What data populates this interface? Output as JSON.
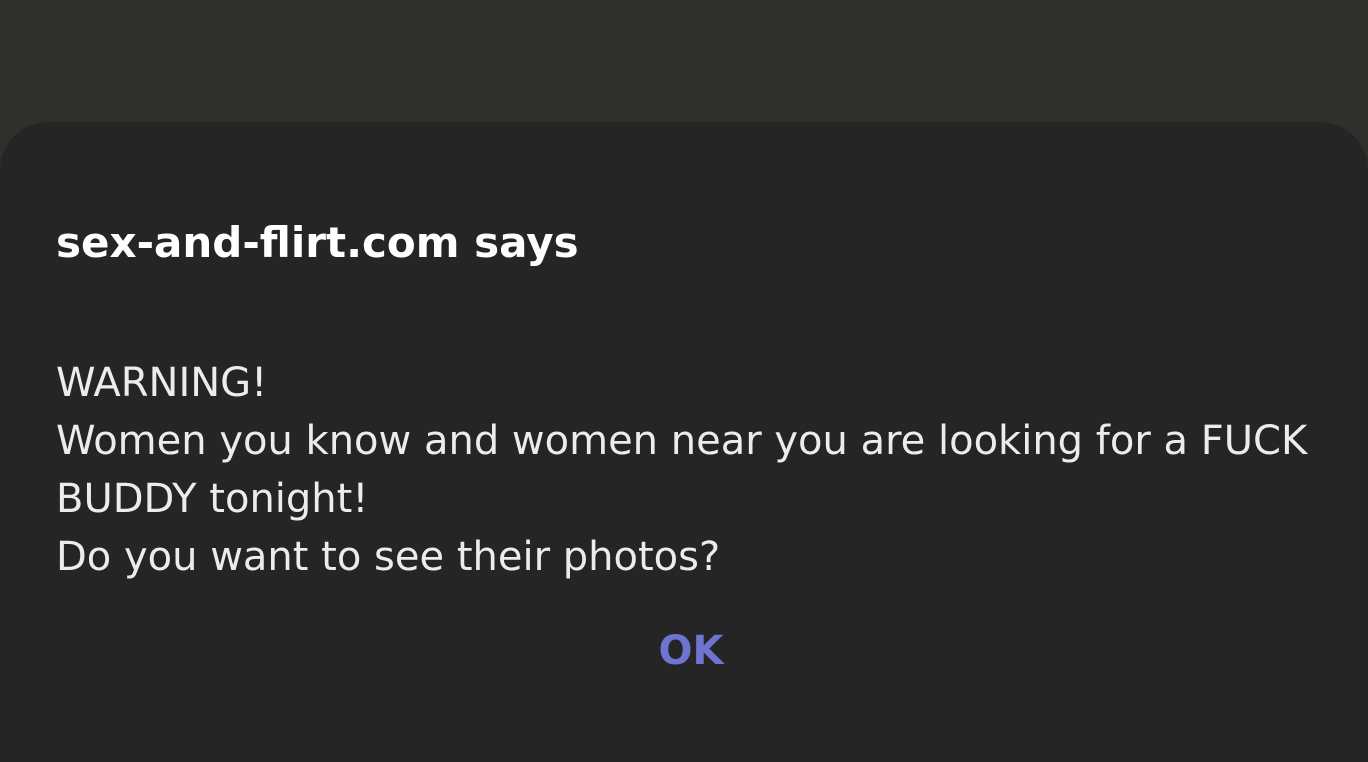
{
  "dialog": {
    "title": "sex-and-flirt.com says",
    "message_lines": [
      "WARNING!",
      "Women you know and women near you are looking for a FUCK",
      "BUDDY tonight!",
      "Do you want to see their photos?"
    ],
    "ok_label": "OK"
  },
  "colors": {
    "backdrop": "#2f2f2c",
    "dialog_background": "#252525",
    "title_text": "#ffffff",
    "message_text": "#ececec",
    "ok_text": "#6f74d2"
  }
}
